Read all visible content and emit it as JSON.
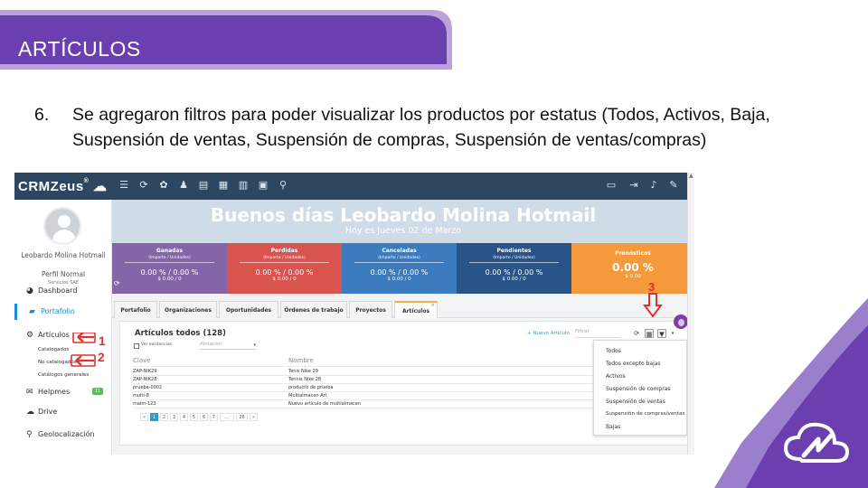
{
  "slide": {
    "title": "ARTÍCULOS",
    "bullet_number": "6.",
    "bullet_text": "Se agregaron filtros para poder visualizar los productos por estatus (Todos, Activos, Baja, Suspensión de ventas, Suspensión de compras, Suspensión de ventas/compras)"
  },
  "colors": {
    "banner": "#6b3fb0",
    "accent": "#1a8bd6",
    "annotation": "#e03030"
  },
  "app": {
    "logo": "CRMZeus",
    "logo_mark": "®",
    "topbar_icons_left": [
      "menu-icon",
      "refresh-icon",
      "palette-icon",
      "cup-icon",
      "document-icon",
      "calendar-icon",
      "book-icon",
      "card-icon",
      "search-icon"
    ],
    "topbar_icons_right": [
      "keyboard-icon",
      "logout-icon",
      "bell-icon",
      "wrench-icon"
    ]
  },
  "sidebar": {
    "user_name": "Leobardo Molina Hotmail",
    "user_role": "Perfil Normal",
    "user_company": "Servicios SAE",
    "items": [
      {
        "label": "Dashboard",
        "icon": "pie-chart-icon"
      },
      {
        "label": "Portafolio",
        "icon": "briefcase-icon"
      },
      {
        "label": "Artículos",
        "icon": "gears-icon"
      },
      {
        "label": "Helpmes",
        "icon": "chat-icon",
        "badge": "11"
      },
      {
        "label": "Drive",
        "icon": "cloud-icon"
      },
      {
        "label": "Geolocalización",
        "icon": "map-marker-icon"
      }
    ],
    "subitems": [
      "Catalogados",
      "No catalogados",
      "Catálogos generales"
    ]
  },
  "hero": {
    "greeting": "Buenos días Leobardo Molina Hotmail",
    "date": "Hoy es Jueves 02 de Marzo"
  },
  "stats": [
    {
      "title": "Ganadas",
      "sub": "(Importe / Unidades)",
      "value": "0.00 % / 0.00 %",
      "money": "$ 0.00 / 0",
      "color": "#8465a8"
    },
    {
      "title": "Perdidas",
      "sub": "(Importe / Unidades)",
      "value": "0.00 % / 0.00 %",
      "money": "$ 0.00 / 0",
      "color": "#d9534f"
    },
    {
      "title": "Canceladas",
      "sub": "(Importe / Unidades)",
      "value": "0.00 % / 0.00 %",
      "money": "$ 0.00 / 0",
      "color": "#3c7bbd"
    },
    {
      "title": "Pendientes",
      "sub": "(Importe / Unidades)",
      "value": "0.00 % / 0.00 %",
      "money": "$ 0.00 / 0",
      "color": "#2a5387"
    },
    {
      "title": "Pronósticos",
      "value": "0.00 %",
      "money": "$ 0.00",
      "color": "#f59a3c"
    }
  ],
  "tabs": [
    "Portafolio",
    "Organizaciones",
    "Oportunidades",
    "Órdenes de trabajo",
    "Proyectos",
    "Artículos"
  ],
  "panel": {
    "title": "Artículos todos (128)",
    "checkbox_label": "Ver existencias",
    "almacen_placeholder": "Almacén",
    "new_button": "+ Nuevo Artículo",
    "filter_placeholder": "Filtrar",
    "columns": [
      "Clave",
      "Nombre"
    ],
    "rows": [
      [
        "ZAP-NIK29",
        "Tenis Nike 29"
      ],
      [
        "ZAP-NIK28",
        "Tennis Nike 28"
      ],
      [
        "prueba-0002",
        "producto de prueba"
      ],
      [
        "multi-8",
        "Multialmacen Art"
      ],
      [
        "maim-123",
        "Nuevo artículo de multialmacen"
      ]
    ],
    "pages": [
      "«",
      "1",
      "2",
      "3",
      "4",
      "5",
      "6",
      "7",
      "…",
      "26",
      "»"
    ]
  },
  "filter_menu": [
    "Todos",
    "Todos excepto bajas",
    "Activos",
    "Suspensión de compras",
    "Suspensión de ventas",
    "Suspensión de compras/ventas",
    "Bajas"
  ],
  "annotations": [
    "1",
    "2",
    "3"
  ]
}
